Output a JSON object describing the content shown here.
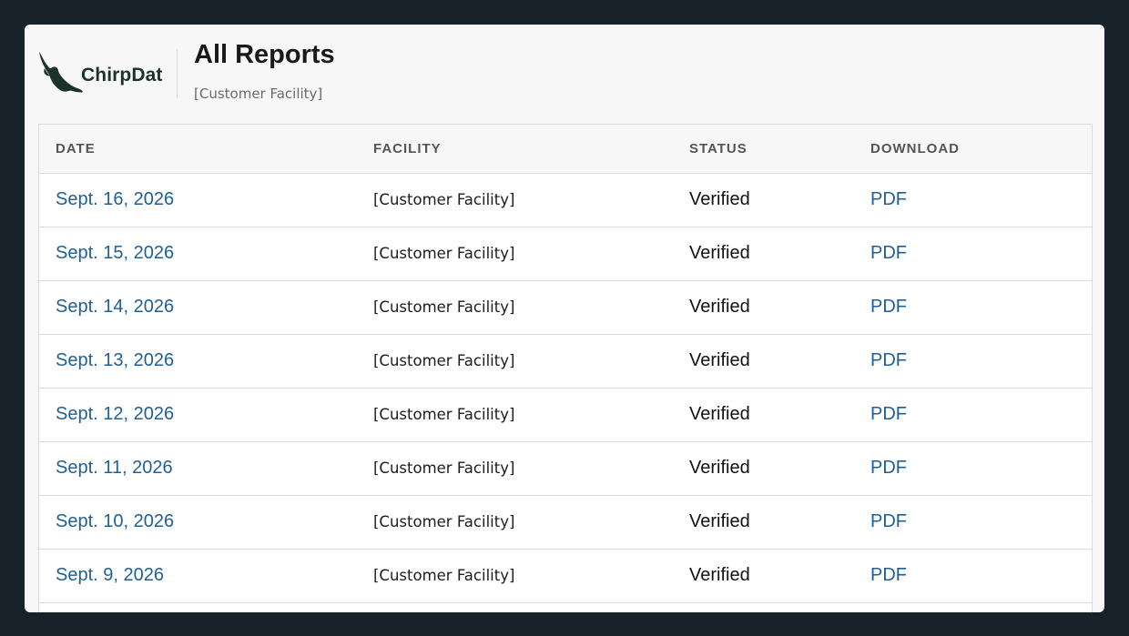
{
  "brand": {
    "name": "ChirpDat",
    "logo_icon": "bird-icon",
    "color": "#1b3328"
  },
  "header": {
    "title": "All Reports",
    "subtitle": "[Customer Facility]"
  },
  "table": {
    "columns": [
      "DATE",
      "FACILITY",
      "STATUS",
      "DOWNLOAD"
    ],
    "rows": [
      {
        "date": "Sept. 16, 2026",
        "facility": "[Customer Facility]",
        "status": "Verified",
        "download": "PDF"
      },
      {
        "date": "Sept. 15, 2026",
        "facility": "[Customer Facility]",
        "status": "Verified",
        "download": "PDF"
      },
      {
        "date": "Sept. 14, 2026",
        "facility": "[Customer Facility]",
        "status": "Verified",
        "download": "PDF"
      },
      {
        "date": "Sept. 13, 2026",
        "facility": "[Customer Facility]",
        "status": "Verified",
        "download": "PDF"
      },
      {
        "date": "Sept. 12, 2026",
        "facility": "[Customer Facility]",
        "status": "Verified",
        "download": "PDF"
      },
      {
        "date": "Sept. 11, 2026",
        "facility": "[Customer Facility]",
        "status": "Verified",
        "download": "PDF"
      },
      {
        "date": "Sept. 10, 2026",
        "facility": "[Customer Facility]",
        "status": "Verified",
        "download": "PDF"
      },
      {
        "date": "Sept. 9, 2026",
        "facility": "[Customer Facility]",
        "status": "Verified",
        "download": "PDF"
      },
      {
        "date": "",
        "facility": "",
        "status": "",
        "download": ""
      }
    ]
  },
  "colors": {
    "background": "#17222a",
    "card": "#f7f7f7",
    "link": "#1f5f96",
    "border": "#dcdcdc"
  }
}
